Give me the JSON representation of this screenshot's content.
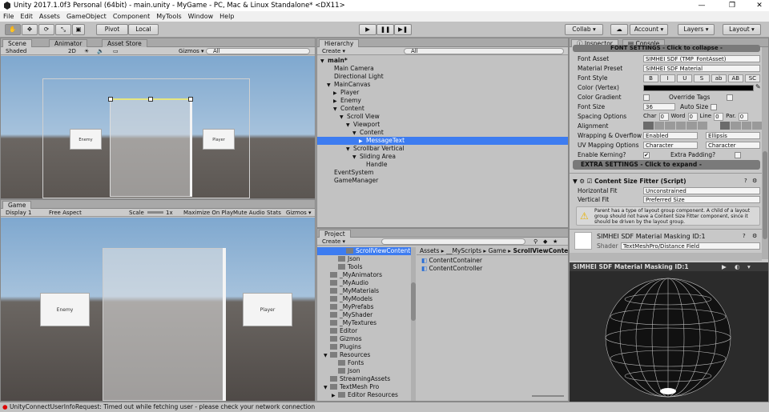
{
  "window": {
    "title": "Unity 2017.1.0f3 Personal (64bit) - main.unity - MyGame - PC, Mac & Linux Standalone* <DX11>",
    "minimize": "—",
    "maximize": "❐",
    "close": "✕"
  },
  "menu": [
    "File",
    "Edit",
    "Assets",
    "GameObject",
    "Component",
    "MyTools",
    "Window",
    "Help"
  ],
  "toolbar": {
    "pivot": "Pivot",
    "local": "Local",
    "collab": "Collab ▾",
    "account": "Account ▾",
    "layers": "Layers ▾",
    "layout": "Layout ▾",
    "play": "▶",
    "pause": "❚❚",
    "step": "▶❚"
  },
  "scene": {
    "tabs": [
      "Scene",
      "Animator",
      "Asset Store"
    ],
    "shading": "Shaded",
    "mode2d": "2D",
    "gizmos": "Gizmos ▾",
    "search": "All",
    "cards": [
      "Enemy",
      "Player"
    ]
  },
  "game": {
    "tab": "Game",
    "display": "Display 1",
    "aspect": "Free Aspect",
    "scale": "Scale",
    "scale_value": "1x",
    "buttons": [
      "Maximize On Play",
      "Mute Audio",
      "Stats",
      "Gizmos ▾"
    ],
    "cards": [
      "Enemy",
      "Player"
    ]
  },
  "hierarchy": {
    "tab": "Hierarchy",
    "create": "Create ▾",
    "search": "All",
    "items": [
      {
        "label": "main*",
        "depth": 0,
        "arrow": "▼",
        "bold": true
      },
      {
        "label": "Main Camera",
        "depth": 1,
        "arrow": ""
      },
      {
        "label": "Directional Light",
        "depth": 1,
        "arrow": ""
      },
      {
        "label": "MainCanvas",
        "depth": 1,
        "arrow": "▼"
      },
      {
        "label": "Player",
        "depth": 2,
        "arrow": "▶"
      },
      {
        "label": "Enemy",
        "depth": 2,
        "arrow": "▶"
      },
      {
        "label": "Content",
        "depth": 2,
        "arrow": "▼"
      },
      {
        "label": "Scroll View",
        "depth": 3,
        "arrow": "▼"
      },
      {
        "label": "Viewport",
        "depth": 4,
        "arrow": "▼"
      },
      {
        "label": "Content",
        "depth": 5,
        "arrow": "▼"
      },
      {
        "label": "MessageText",
        "depth": 6,
        "arrow": "▶",
        "selected": true
      },
      {
        "label": "Scrollbar Vertical",
        "depth": 4,
        "arrow": "▼"
      },
      {
        "label": "Sliding Area",
        "depth": 5,
        "arrow": "▼"
      },
      {
        "label": "Handle",
        "depth": 6,
        "arrow": ""
      },
      {
        "label": "EventSystem",
        "depth": 1,
        "arrow": ""
      },
      {
        "label": "GameManager",
        "depth": 1,
        "arrow": ""
      }
    ]
  },
  "project": {
    "tab": "Project",
    "create": "Create ▾",
    "breadcrumb": [
      "Assets",
      "__MyScripts",
      "Game",
      "ScrollViewContent"
    ],
    "folders": [
      {
        "label": "ScrollViewContent",
        "depth": 2,
        "selected": true
      },
      {
        "label": "Json",
        "depth": 1
      },
      {
        "label": "Tools",
        "depth": 1
      },
      {
        "label": "_MyAnimators",
        "depth": 0
      },
      {
        "label": "_MyAudio",
        "depth": 0
      },
      {
        "label": "_MyMaterials",
        "depth": 0
      },
      {
        "label": "_MyModels",
        "depth": 0
      },
      {
        "label": "_MyPrefabs",
        "depth": 0
      },
      {
        "label": "_MyShader",
        "depth": 0
      },
      {
        "label": "_MyTextures",
        "depth": 0
      },
      {
        "label": "Editor",
        "depth": 0
      },
      {
        "label": "Gizmos",
        "depth": 0
      },
      {
        "label": "Plugins",
        "depth": 0
      },
      {
        "label": "Resources",
        "depth": 0,
        "arrow": "▼"
      },
      {
        "label": "Fonts",
        "depth": 1
      },
      {
        "label": "Json",
        "depth": 1
      },
      {
        "label": "StreamingAssets",
        "depth": 0
      },
      {
        "label": "TextMesh Pro",
        "depth": 0,
        "arrow": "▼"
      },
      {
        "label": "Editor Resources",
        "depth": 1,
        "arrow": "▶"
      }
    ],
    "files": [
      "ContentContainer",
      "ContentController"
    ]
  },
  "inspector": {
    "tabs": [
      "Inspector",
      "Console"
    ],
    "font_settings_header": "FONT SETTINGS - Click to collapse -",
    "rows": [
      {
        "label": "Font Asset",
        "value": "SIMHEI SDF (TMP_FontAsset)"
      },
      {
        "label": "Material Preset",
        "value": "SIMHEI SDF Material"
      },
      {
        "label": "Font Style",
        "value": ""
      },
      {
        "label": "Color (Vertex)",
        "value": ""
      },
      {
        "label": "Color Gradient",
        "value": ""
      },
      {
        "label": "Font Size",
        "value": "36"
      },
      {
        "label": "Spacing Options",
        "value": ""
      },
      {
        "label": "Alignment",
        "value": ""
      },
      {
        "label": "Wrapping & Overflow",
        "value": "Enabled"
      },
      {
        "label": "UV Mapping Options",
        "value": "Character"
      },
      {
        "label": "Enable Kerning?",
        "value": ""
      }
    ],
    "font_styles": [
      "B",
      "I",
      "U",
      "S",
      "ab",
      "AB",
      "SC"
    ],
    "override_tags": "Override Tags",
    "auto_size": "Auto Size",
    "spacing": [
      {
        "k": "Char",
        "v": "0"
      },
      {
        "k": "Word",
        "v": "0"
      },
      {
        "k": "Line",
        "v": "0"
      },
      {
        "k": "Par.",
        "v": "0"
      }
    ],
    "overflow": "Ellipsis",
    "uv2": "Character",
    "extra_padding": "Extra Padding?",
    "extra_settings": "EXTRA SETTINGS - Click to expand -",
    "csf_title": "Content Size Fitter (Script)",
    "horizontal_fit": {
      "label": "Horizontal Fit",
      "value": "Unconstrained"
    },
    "vertical_fit": {
      "label": "Vertical Fit",
      "value": "Preferred Size"
    },
    "warning": "Parent has a type of layout group component. A child of a layout group should not have a Content Size Fitter component, since it should be driven by the layout group.",
    "material_title": "SIMHEI SDF Material Masking ID:1",
    "shader_label": "Shader",
    "shader_value": "TextMeshPro/Distance Field",
    "preview_title": "SIMHEI SDF Material Masking ID:1"
  },
  "status": {
    "message": "UnityConnectUserInfoRequest: Timed out while fetching user - please check your network connection"
  },
  "colors": {
    "accent": "#3d7cf0",
    "panel": "#c2c2c2",
    "scene_sky": "#8db4d8",
    "scene_ground": "#4a4542"
  }
}
